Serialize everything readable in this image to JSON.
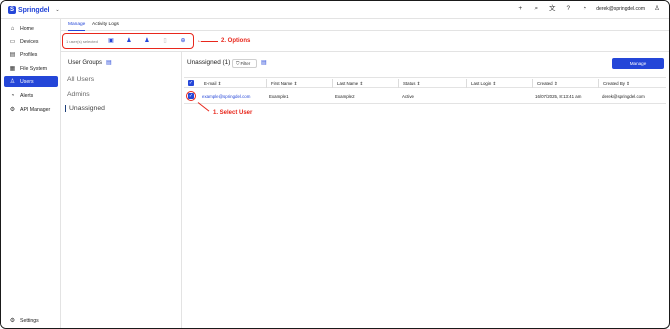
{
  "app": {
    "logo_text": "Springdel",
    "logo_mark": "S"
  },
  "topbar": {
    "user_email": "derek@springdel.com",
    "icons": [
      "plus-icon",
      "search-icon",
      "translate-icon",
      "help-icon",
      "bell-icon",
      "user-icon"
    ]
  },
  "sidebar": {
    "items": [
      {
        "label": "Home",
        "icon": "home-icon",
        "glyph": "⌂",
        "active": false
      },
      {
        "label": "Devices",
        "icon": "devices-icon",
        "glyph": "▭",
        "active": false
      },
      {
        "label": "Profiles",
        "icon": "profiles-icon",
        "glyph": "▤",
        "active": false
      },
      {
        "label": "File System",
        "icon": "folder-icon",
        "glyph": "▦",
        "active": false
      },
      {
        "label": "Users",
        "icon": "users-icon",
        "glyph": "♙",
        "active": true
      },
      {
        "label": "Alerts",
        "icon": "bell-icon",
        "glyph": "◔",
        "active": false
      },
      {
        "label": "API Manager",
        "icon": "gear-icon",
        "glyph": "⚙",
        "active": false
      }
    ],
    "settings_label": "Settings"
  },
  "tabs": [
    {
      "label": "Manage",
      "active": true
    },
    {
      "label": "Activity Logs",
      "active": false
    }
  ],
  "toolbar": {
    "selected_text": "1 user(s) selected",
    "options_callout": "2. Options",
    "icons": [
      "move-folder-icon",
      "user-edit-icon",
      "user-icon",
      "trash-icon",
      "add-circle-icon"
    ]
  },
  "groups": {
    "title": "User Groups",
    "items": [
      {
        "label": "All Users",
        "active": false
      },
      {
        "label": "Admins",
        "active": false
      },
      {
        "label": "Unassigned",
        "active": true
      }
    ]
  },
  "main": {
    "heading": "Unassigned (1)",
    "filter_label": "Filter",
    "manage_label": "Manage",
    "columns": [
      "E-mail ⇕",
      "First Name ⇕",
      "Last Name ⇕",
      "Status ⇕",
      "Last Login ⇕",
      "Created ⇕",
      "Created By ⇕"
    ],
    "rows": [
      {
        "email": "example@springdel.com",
        "first_name": "Example1",
        "last_name": "Example2",
        "status": "Active",
        "last_login": "",
        "created": "16/07/2025, 8:13:41 am",
        "created_by": "derek@springdel.com"
      }
    ],
    "select_callout": "1. Select User"
  },
  "colors": {
    "accent": "#2446d8",
    "annotation": "#e8271c"
  }
}
